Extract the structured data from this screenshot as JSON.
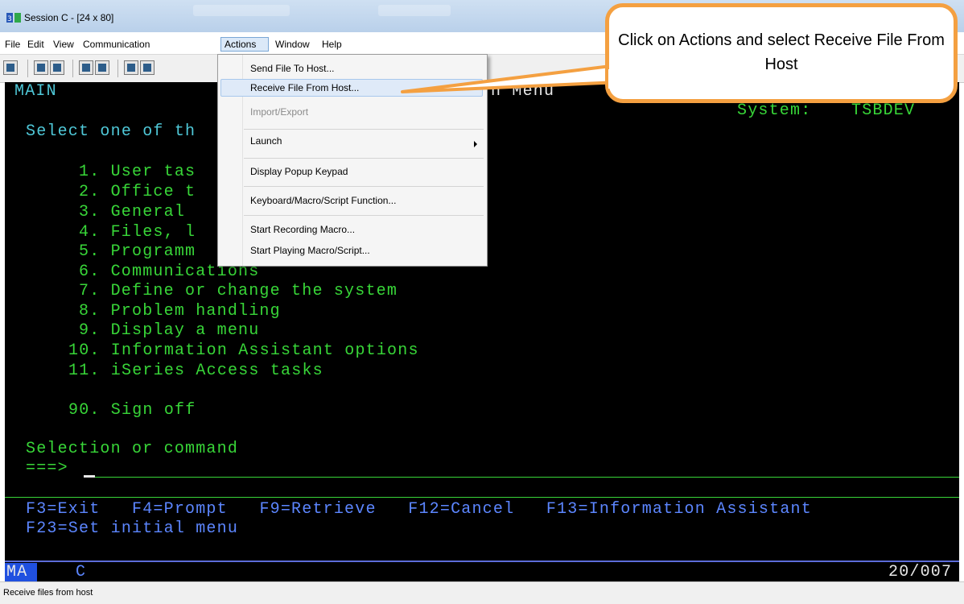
{
  "window": {
    "title": "Session C - [24 x 80]"
  },
  "menubar": {
    "items": [
      "File",
      "Edit",
      "View",
      "Communication",
      "Actions",
      "Window",
      "Help"
    ],
    "active": "Actions"
  },
  "toolbar": {
    "buttons": [
      "print-screen-icon",
      "copy-icon",
      "paste-icon",
      "send-file-icon",
      "receive-file-icon",
      "display-keypad-icon",
      "macro-icon"
    ]
  },
  "actions_menu": {
    "items": [
      {
        "label": "Send File To Host...",
        "enabled": true
      },
      {
        "label": "Receive File From Host...",
        "enabled": true,
        "highlighted": true
      },
      {
        "label": "Import/Export",
        "enabled": false
      },
      {
        "label": "Launch",
        "enabled": true,
        "submenu": true
      },
      {
        "label": "Display Popup Keypad",
        "enabled": true
      },
      {
        "label": "Keyboard/Macro/Script Function...",
        "enabled": true
      },
      {
        "label": "Start Recording Macro...",
        "enabled": true
      },
      {
        "label": "Start Playing Macro/Script...",
        "enabled": true
      }
    ]
  },
  "terminal": {
    "menu_id": "MAIN",
    "title_fragment": "n Menu",
    "system_label": "System:",
    "system_name": "TSBDEV",
    "prompt": "Select one of th",
    "options": [
      "1. User tas",
      "2. Office t",
      "3. General ",
      "4. Files, l",
      "5. Programm",
      "6. Communications",
      "7. Define or change the system",
      "8. Problem handling",
      "9. Display a menu",
      "10. Information Assistant options",
      "11. iSeries Access tasks",
      "90. Sign off"
    ],
    "selection_label": "Selection or command",
    "command_prompt": "===>",
    "function_keys_1": "F3=Exit   F4=Prompt   F9=Retrieve   F12=Cancel   F13=Information Assistant",
    "function_keys_2": "F23=Set initial menu",
    "oia_left": "MA",
    "oia_session": "C",
    "oia_cursor": "20/007"
  },
  "statusbar": {
    "text": "Receive files from host"
  },
  "callout": {
    "text": "Click on Actions and select Receive File From Host"
  },
  "colors": {
    "terminal_green": "#38d638",
    "terminal_background": "#000000",
    "callout_border": "#f4a041",
    "menu_highlight": "#dfeaf8"
  }
}
